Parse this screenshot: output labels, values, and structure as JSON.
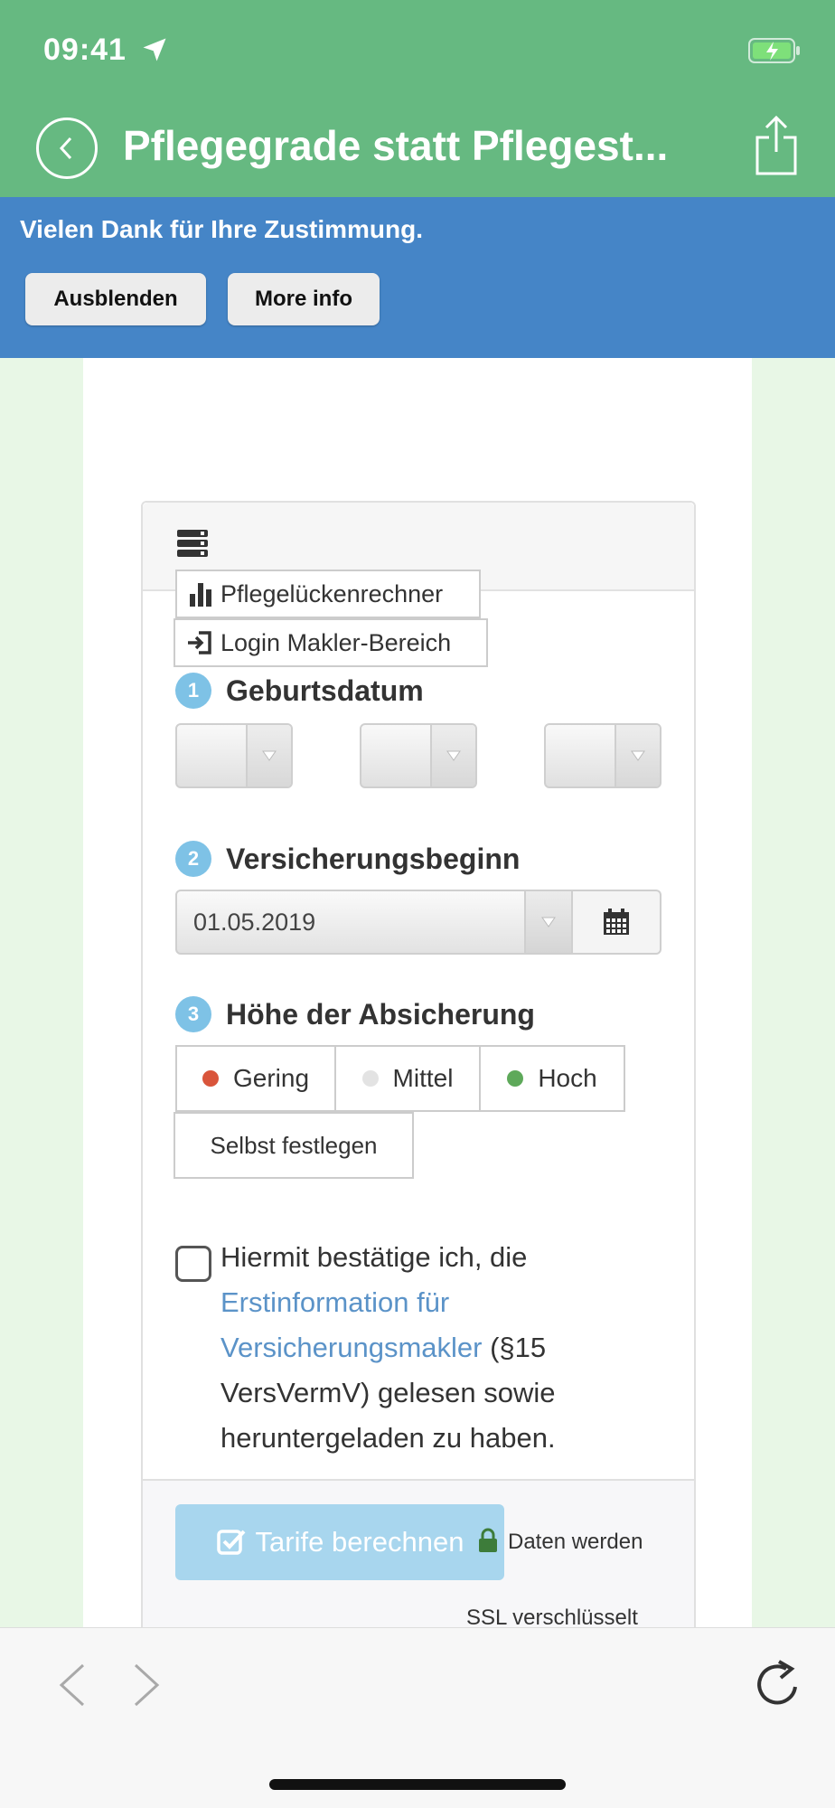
{
  "status_bar": {
    "time": "09:41"
  },
  "nav": {
    "title": "Pflegegrade statt Pflegest..."
  },
  "consent_banner": {
    "message": "Vielen Dank für Ihre Zustimmung.",
    "hide_label": "Ausblenden",
    "info_label": "More info"
  },
  "links": {
    "calculator": "Pflegelückenrechner",
    "login": "Login Makler-Bereich"
  },
  "steps": [
    {
      "num": "1",
      "label": "Geburtsdatum"
    },
    {
      "num": "2",
      "label": "Versicherungsbeginn"
    },
    {
      "num": "3",
      "label": "Höhe der Absicherung"
    }
  ],
  "insurance_start": {
    "value": "01.05.2019"
  },
  "levels": [
    {
      "label": "Gering",
      "color": "#d9553b"
    },
    {
      "label": "Mittel",
      "color": "#e3e3e3"
    },
    {
      "label": "Hoch",
      "color": "#5ea95a"
    }
  ],
  "custom_label": "Selbst festlegen",
  "agreement": {
    "part1": "Hiermit bestätige ich, die ",
    "link": "Erstinformation für Versicherungsmakler",
    "part2": " (§15 VersVermV) gelesen sowie heruntergeladen zu haben."
  },
  "submit": {
    "label": "Tarife berechnen",
    "ssl_line1": "Daten werden",
    "ssl_line2": "SSL verschlüsselt"
  },
  "colors": {
    "header": "#66b981",
    "banner": "#4585c7",
    "accent": "#7ec2e6"
  }
}
